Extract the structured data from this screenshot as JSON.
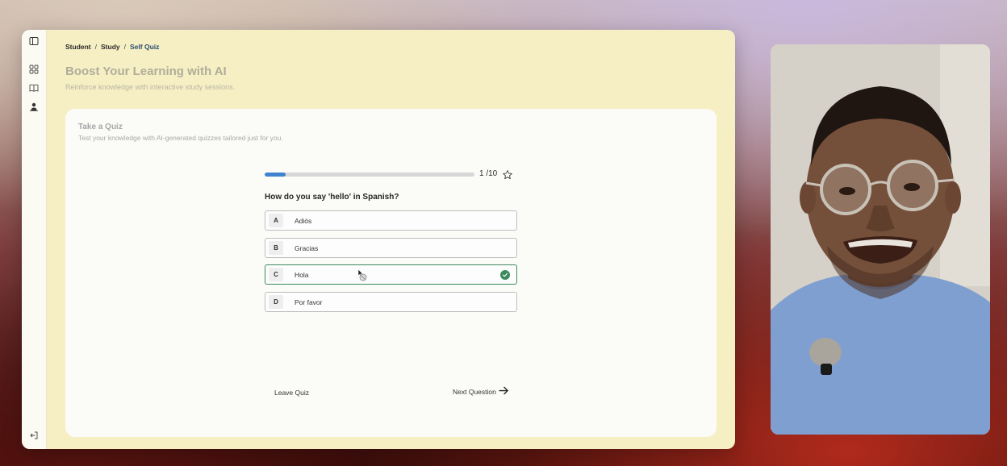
{
  "breadcrumb": {
    "items": [
      "Student",
      "Study",
      "Self Quiz"
    ],
    "separator": "/"
  },
  "header": {
    "title": "Boost Your Learning with AI",
    "subtitle": "Reinforce knowledge with interactive study sessions."
  },
  "card": {
    "title": "Take a Quiz",
    "subtitle": "Test your knowledge with AI-generated quizzes tailored just for you."
  },
  "quiz": {
    "progress_label": "1 /10",
    "progress_fraction": 0.1,
    "question": "How do you say 'hello' in Spanish?",
    "options": [
      {
        "letter": "A",
        "text": "Adiós"
      },
      {
        "letter": "B",
        "text": "Gracias"
      },
      {
        "letter": "C",
        "text": "Hola"
      },
      {
        "letter": "D",
        "text": "Por favor"
      }
    ],
    "selected_index": 2,
    "leave_label": "Leave Quiz",
    "next_label": "Next Question"
  },
  "icons": {
    "rail": [
      "sidebar-toggle-icon",
      "dashboard-icon",
      "book-icon",
      "upload-user-icon",
      "logout-icon"
    ],
    "favorite": "star-icon",
    "correct": "check-circle-icon",
    "next": "arrow-right-icon"
  },
  "colors": {
    "window_bg": "#f6efc4",
    "accent_blue": "#3f82cf",
    "correct_green": "#3d8a5f"
  }
}
